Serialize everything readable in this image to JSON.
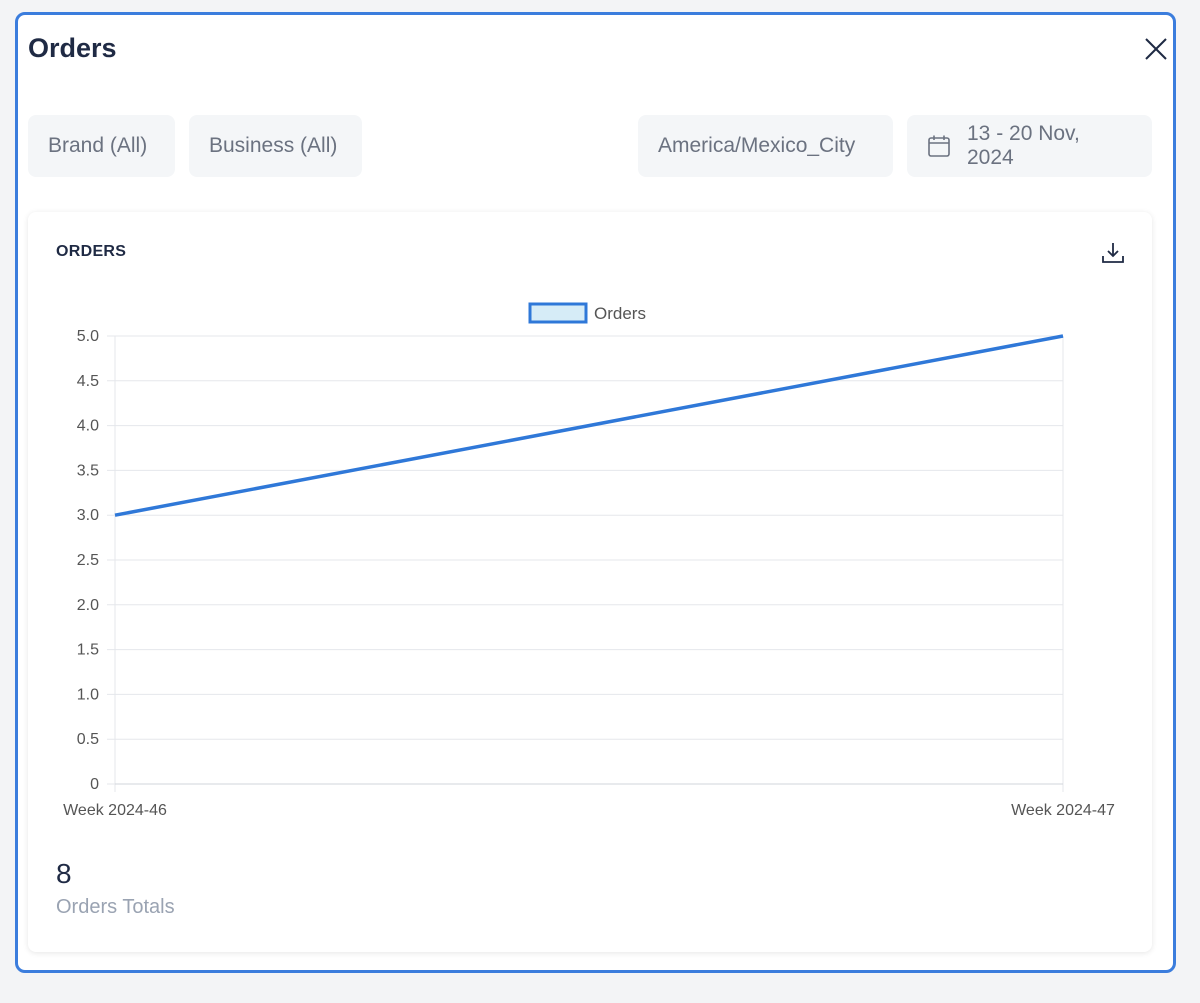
{
  "modal": {
    "title": "Orders"
  },
  "filters": {
    "brand": "Brand (All)",
    "business": "Business (All)",
    "timezone": "America/Mexico_City",
    "date_range": "13 - 20 Nov, 2024"
  },
  "card": {
    "title": "ORDERS",
    "total_value": "8",
    "total_label": "Orders Totals"
  },
  "colors": {
    "accent": "#3b7ddd",
    "line": "#2f78d8",
    "legend_fill": "#d6ecf7",
    "grid": "#e5e7eb",
    "tick_text": "#555555"
  },
  "icons": {
    "close": "close-icon",
    "calendar": "calendar-icon",
    "download": "download-icon"
  },
  "chart_data": {
    "type": "line",
    "categories": [
      "Week 2024-46",
      "Week 2024-47"
    ],
    "series": [
      {
        "name": "Orders",
        "values": [
          3,
          5
        ]
      }
    ],
    "ylim": [
      0,
      5
    ],
    "yticks": [
      "0",
      "0.5",
      "1.0",
      "1.5",
      "2.0",
      "2.5",
      "3.0",
      "3.5",
      "4.0",
      "4.5",
      "5.0"
    ],
    "ytick_values": [
      0,
      0.5,
      1,
      1.5,
      2,
      2.5,
      3,
      3.5,
      4,
      4.5,
      5
    ],
    "grid": true,
    "legend": "top-center"
  }
}
